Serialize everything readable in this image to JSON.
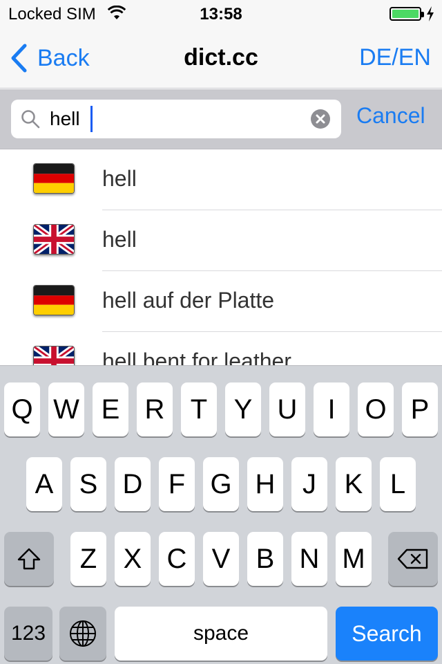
{
  "status_bar": {
    "carrier": "Locked SIM",
    "time": "13:58",
    "battery_level": 1.0,
    "battery_color": "#4cd964",
    "icons": [
      "wifi-icon",
      "battery-icon",
      "charging-bolt-icon"
    ]
  },
  "nav": {
    "back_label": "Back",
    "title": "dict.cc",
    "language_pair": "DE/EN",
    "accent_color": "#1a7cf2"
  },
  "search": {
    "query": "hell",
    "cancel_label": "Cancel",
    "icons": [
      "magnifier-icon",
      "clear-icon"
    ]
  },
  "results": [
    {
      "flag": "german-flag-icon",
      "text": "hell"
    },
    {
      "flag": "uk-flag-icon",
      "text": "hell"
    },
    {
      "flag": "german-flag-icon",
      "text": "hell auf der Platte"
    },
    {
      "flag": "uk-flag-icon",
      "text": "hell bent for leather"
    }
  ],
  "keyboard": {
    "row1": [
      "Q",
      "W",
      "E",
      "R",
      "T",
      "Y",
      "U",
      "I",
      "O",
      "P"
    ],
    "row2": [
      "A",
      "S",
      "D",
      "F",
      "G",
      "H",
      "J",
      "K",
      "L"
    ],
    "row3": [
      "Z",
      "X",
      "C",
      "V",
      "B",
      "N",
      "M"
    ],
    "numbers_label": "123",
    "space_label": "space",
    "search_label": "Search",
    "icons": [
      "shift-icon",
      "delete-icon",
      "globe-icon"
    ],
    "search_key_color": "#1a82fb"
  }
}
